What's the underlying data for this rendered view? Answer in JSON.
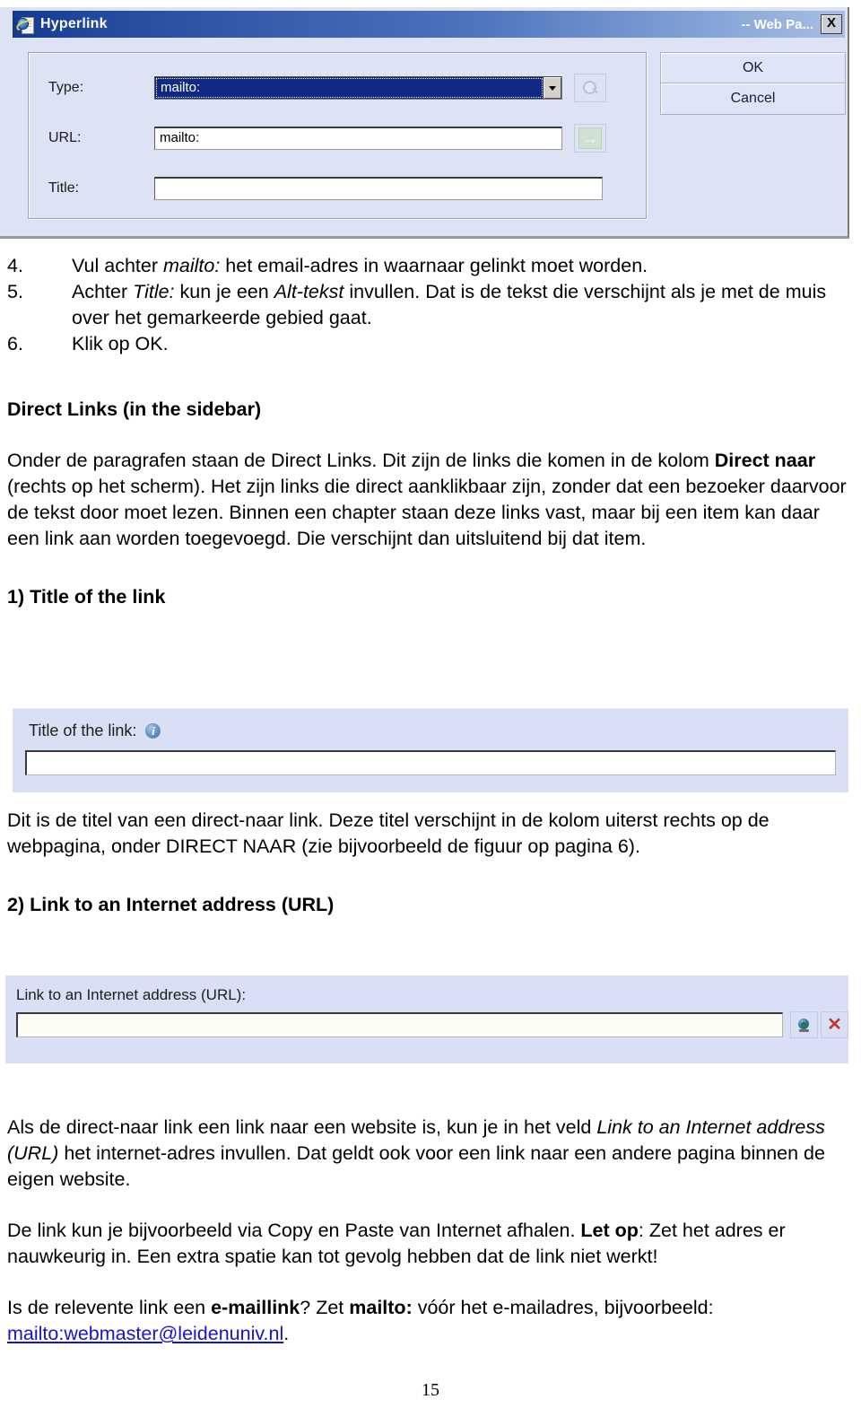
{
  "dialog": {
    "title": "Hyperlink",
    "title_truncated": "-- Web Pa...",
    "close_label": "X",
    "fields": {
      "type_label": "Type:",
      "type_value": "mailto:",
      "url_label": "URL:",
      "url_value": "mailto:",
      "title_label": "Title:",
      "title_value": ""
    },
    "buttons": {
      "ok": "OK",
      "cancel": "Cancel"
    },
    "icons": {
      "browse": "search-icon",
      "go": "go-arrow-icon",
      "app": "internet-explorer-page-icon"
    },
    "colors": {
      "background": "#dde2f5",
      "titlebar_start": "#123a8f",
      "titlebar_end": "#a8bfe4",
      "selection": "#102a83"
    }
  },
  "steps": [
    {
      "num": "4.",
      "parts": [
        {
          "t": "Vul achter ",
          "s": "n"
        },
        {
          "t": "mailto:",
          "s": "i"
        },
        {
          "t": " het email-adres in waarnaar gelinkt moet worden.",
          "s": "n"
        }
      ]
    },
    {
      "num": "5.",
      "parts": [
        {
          "t": "Achter ",
          "s": "n"
        },
        {
          "t": "Title:",
          "s": "i"
        },
        {
          "t": " kun je een ",
          "s": "n"
        },
        {
          "t": "Alt-tekst",
          "s": "i"
        },
        {
          "t": " invullen. Dat is de tekst die verschijnt als je met de muis over het gemarkeerde gebied gaat.",
          "s": "n"
        }
      ]
    },
    {
      "num": "6.",
      "parts": [
        {
          "t": "Klik op OK.",
          "s": "n"
        }
      ]
    }
  ],
  "section_direct_links": {
    "heading": "Direct Links (in the sidebar)",
    "paragraph": [
      {
        "t": "Onder de paragrafen staan de Direct Links. Dit zijn de links die komen in de kolom ",
        "s": "n"
      },
      {
        "t": "Direct naar ",
        "s": "b"
      },
      {
        "t": "(rechts op het scherm). Het zijn links die direct aanklikbaar zijn, zonder dat een bezoeker daarvoor de tekst door moet lezen. Binnen een chapter staan deze links vast, maar bij een item kan daar een link aan worden toegevoegd. Die verschijnt dan uitsluitend bij dat item.",
        "s": "n"
      }
    ]
  },
  "section_title_link": {
    "heading": "1) Title of the link",
    "widget": {
      "label": "Title of the link:",
      "value": "",
      "info_icon": "info-icon",
      "info_glyph": "i"
    },
    "paragraph": [
      {
        "t": "Dit is de titel van een direct-naar link. Deze titel verschijnt in de kolom uiterst rechts op de webpagina, onder DIRECT NAAR (zie bijvoorbeeld de figuur op pagina 6).",
        "s": "n"
      }
    ]
  },
  "section_url_link": {
    "heading": "2) Link to an Internet address (URL)",
    "widget": {
      "label": "Link to an Internet address (URL):",
      "value": "",
      "icons": [
        "globe-browse-icon",
        "clear-x-icon"
      ],
      "clear_glyph": "✕"
    },
    "paragraph_1": [
      {
        "t": "Als de direct-naar link een link naar een website is, kun je in het veld ",
        "s": "n"
      },
      {
        "t": "Link to an Internet address (URL)",
        "s": "i"
      },
      {
        "t": " het internet-adres invullen. Dat geldt ook voor een link naar een andere pagina binnen de eigen website.",
        "s": "n"
      }
    ],
    "paragraph_2": [
      {
        "t": "De link kun je bijvoorbeeld via Copy en Paste van Internet afhalen. ",
        "s": "n"
      },
      {
        "t": "Let op",
        "s": "b"
      },
      {
        "t": ": Zet het adres er nauwkeurig in. Een extra spatie kan tot gevolg hebben dat de link niet werkt!",
        "s": "n"
      }
    ],
    "paragraph_3": [
      {
        "t": "Is de relevente link een ",
        "s": "n"
      },
      {
        "t": "e-maillink",
        "s": "b"
      },
      {
        "t": "? Zet ",
        "s": "n"
      },
      {
        "t": "mailto:",
        "s": "b"
      },
      {
        "t": " vóór het e-mailadres, bijvoorbeeld: ",
        "s": "n"
      },
      {
        "t": "mailto:webmaster@leidenuniv.nl",
        "s": "a"
      },
      {
        "t": ".",
        "s": "n"
      }
    ]
  },
  "page_number": "15"
}
